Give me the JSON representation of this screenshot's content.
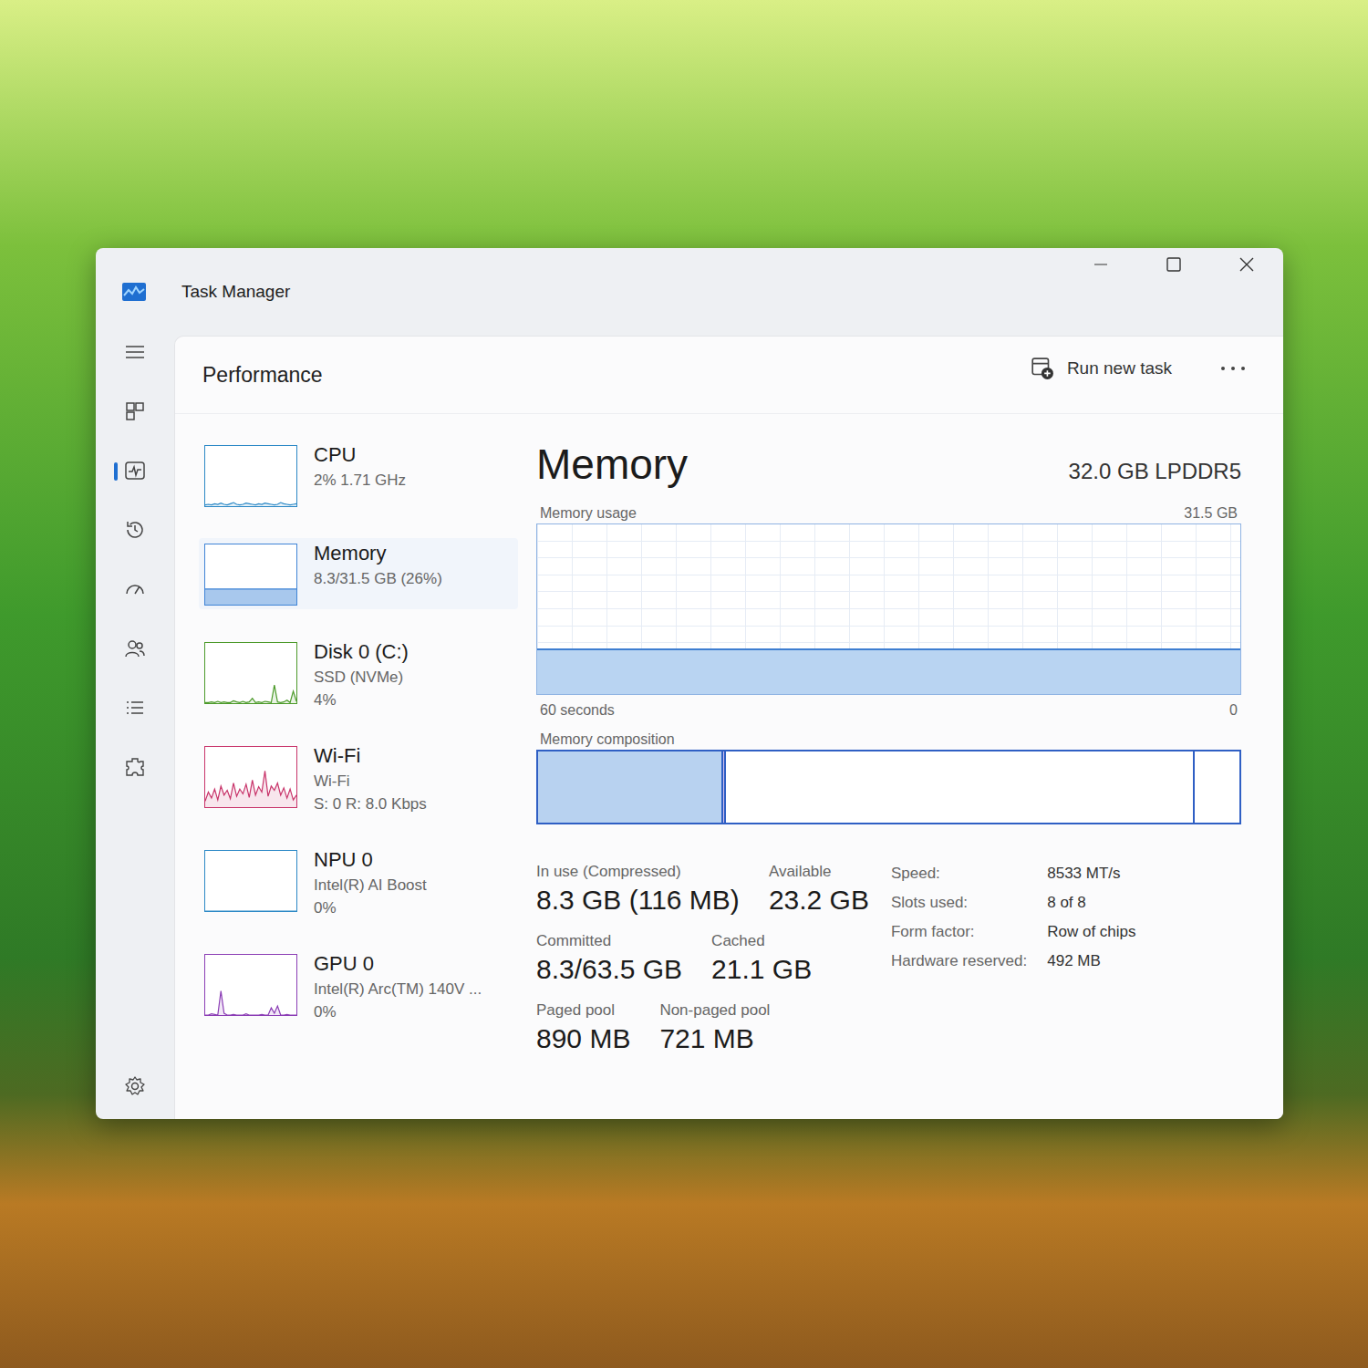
{
  "window": {
    "title": "Task Manager"
  },
  "nav": [
    {
      "kind": "processes",
      "selected": false
    },
    {
      "kind": "performance",
      "selected": true
    },
    {
      "kind": "history",
      "selected": false
    },
    {
      "kind": "startup",
      "selected": false
    },
    {
      "kind": "users",
      "selected": false
    },
    {
      "kind": "details",
      "selected": false
    },
    {
      "kind": "services",
      "selected": false
    }
  ],
  "page": {
    "title": "Performance",
    "run_task": "Run new task"
  },
  "perf_list": [
    {
      "name": "CPU",
      "lines": [
        "2% 1.71 GHz"
      ],
      "selected": false,
      "kind": "line",
      "color": "#2b88c6",
      "values": [
        2,
        3,
        2,
        4,
        3,
        5,
        3,
        2,
        4,
        6,
        3,
        2,
        3,
        5,
        4,
        3,
        2,
        4,
        3,
        5,
        4,
        3,
        2,
        3,
        6,
        4,
        3,
        2,
        3,
        4
      ]
    },
    {
      "name": "Memory",
      "lines": [
        "8.3/31.5 GB (26%)"
      ],
      "selected": true,
      "kind": "area",
      "color": "#3f84d6",
      "values": [
        26,
        26,
        26,
        26,
        26,
        26,
        26,
        26,
        26,
        26,
        26,
        26,
        26,
        26,
        26,
        26,
        26,
        26,
        26,
        26,
        26,
        26,
        26,
        26,
        26,
        26,
        26,
        26,
        26,
        26
      ]
    },
    {
      "name": "Disk 0 (C:)",
      "lines": [
        "SSD (NVMe)",
        "4%"
      ],
      "selected": false,
      "kind": "line",
      "color": "#4c9a2a",
      "values": [
        1,
        1,
        2,
        1,
        3,
        1,
        2,
        1,
        1,
        4,
        2,
        1,
        3,
        1,
        2,
        8,
        1,
        2,
        1,
        3,
        2,
        1,
        30,
        2,
        1,
        2,
        5,
        1,
        20,
        3
      ]
    },
    {
      "name": "Wi-Fi",
      "lines": [
        "Wi-Fi",
        "S: 0 R: 8.0 Kbps"
      ],
      "selected": false,
      "kind": "line",
      "color": "#c8346a",
      "values": [
        10,
        25,
        15,
        30,
        12,
        35,
        20,
        28,
        14,
        40,
        18,
        30,
        22,
        38,
        16,
        45,
        20,
        34,
        25,
        60,
        18,
        35,
        28,
        40,
        20,
        32,
        15,
        30,
        12,
        20
      ]
    },
    {
      "name": "NPU 0",
      "lines": [
        "Intel(R) AI Boost",
        "0%"
      ],
      "selected": false,
      "kind": "line",
      "color": "#2b88c6",
      "values": [
        0,
        0,
        0,
        0,
        0,
        0,
        0,
        0,
        0,
        0,
        0,
        0,
        0,
        0,
        0,
        0,
        0,
        0,
        0,
        0,
        0,
        0,
        0,
        0,
        0,
        0,
        0,
        0,
        0,
        0
      ]
    },
    {
      "name": "GPU 0",
      "lines": [
        "Intel(R) Arc(TM) 140V ...",
        "0%"
      ],
      "selected": false,
      "kind": "line",
      "color": "#8b3db5",
      "values": [
        0,
        0,
        2,
        1,
        0,
        40,
        3,
        0,
        0,
        1,
        0,
        0,
        0,
        2,
        0,
        0,
        0,
        0,
        1,
        0,
        0,
        12,
        3,
        15,
        0,
        0,
        1,
        0,
        0,
        0
      ]
    }
  ],
  "detail": {
    "title": "Memory",
    "spec": "32.0 GB LPDDR5",
    "usage": {
      "label": "Memory usage",
      "max_label": "31.5 GB",
      "max_value": 31.5,
      "time_label": "60 seconds",
      "zero_label": "0",
      "values": [
        8.3,
        8.3,
        8.3,
        8.3,
        8.3,
        8.3,
        8.3,
        8.3,
        8.3,
        8.3,
        8.3,
        8.3,
        8.3,
        8.3,
        8.3,
        8.3,
        8.3,
        8.3,
        8.3,
        8.3,
        8.3,
        8.3,
        8.3,
        8.3,
        8.3,
        8.3,
        8.3,
        8.3,
        8.3,
        8.3
      ]
    },
    "composition": {
      "label": "Memory composition",
      "segments": [
        {
          "kind": "in-use",
          "level": 0.264
        },
        {
          "kind": "modified",
          "level": 0.004
        },
        {
          "kind": "standby",
          "level": 0.668
        },
        {
          "kind": "free",
          "level": 0.064
        }
      ]
    },
    "stats": [
      [
        {
          "label": "In use (Compressed)",
          "value": "8.3 GB (116 MB)"
        },
        {
          "label": "Available",
          "value": "23.2 GB"
        }
      ],
      [
        {
          "label": "Committed",
          "value": "8.3/63.5 GB"
        },
        {
          "label": "Cached",
          "value": "21.1 GB"
        }
      ],
      [
        {
          "label": "Paged pool",
          "value": "890 MB"
        },
        {
          "label": "Non-paged pool",
          "value": "721 MB"
        }
      ]
    ],
    "specs": [
      {
        "label": "Speed:",
        "value": "8533 MT/s"
      },
      {
        "label": "Slots used:",
        "value": "8 of 8"
      },
      {
        "label": "Form factor:",
        "value": "Row of chips"
      },
      {
        "label": "Hardware reserved:",
        "value": "492 MB"
      }
    ]
  }
}
